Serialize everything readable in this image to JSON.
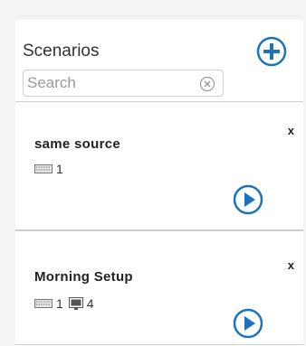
{
  "panel": {
    "title": "Scenarios",
    "search": {
      "placeholder": "Search",
      "value": ""
    },
    "icons": {
      "add": "plus-circle-icon",
      "clear": "clear-search-icon"
    },
    "accent_color": "#1e73b8"
  },
  "scenarios": [
    {
      "name": "same source",
      "remove_label": "x",
      "sources": [
        {
          "icon": "keyboard-icon",
          "count": "1"
        }
      ]
    },
    {
      "name": "Morning Setup",
      "remove_label": "x",
      "sources": [
        {
          "icon": "keyboard-icon",
          "count": "1"
        },
        {
          "icon": "monitor-icon",
          "count": "4"
        }
      ]
    }
  ]
}
